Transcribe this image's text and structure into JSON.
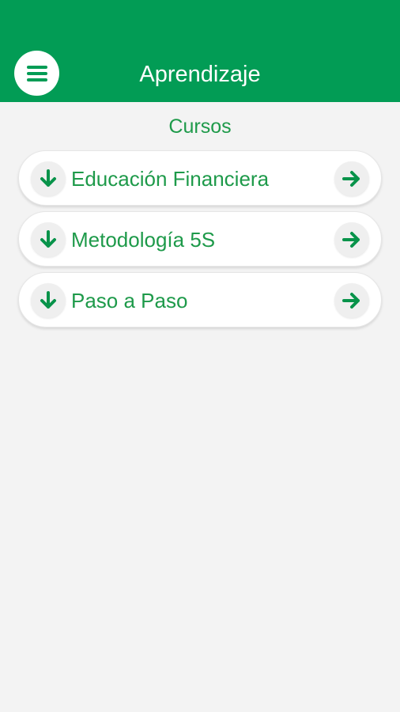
{
  "header": {
    "title": "Aprendizaje",
    "menu_icon": "hamburger-menu-icon",
    "background_color": "#029c55"
  },
  "section": {
    "title": "Cursos"
  },
  "courses": [
    {
      "label": "Educación Financiera",
      "expand_icon": "arrow-down-icon",
      "open_icon": "arrow-right-icon"
    },
    {
      "label": "Metodología 5S",
      "expand_icon": "arrow-down-icon",
      "open_icon": "arrow-right-icon"
    },
    {
      "label": "Paso a Paso",
      "expand_icon": "arrow-down-icon",
      "open_icon": "arrow-right-icon"
    }
  ],
  "colors": {
    "accent": "#1e9a4a",
    "background": "#f3f3f3",
    "card": "#ffffff"
  }
}
